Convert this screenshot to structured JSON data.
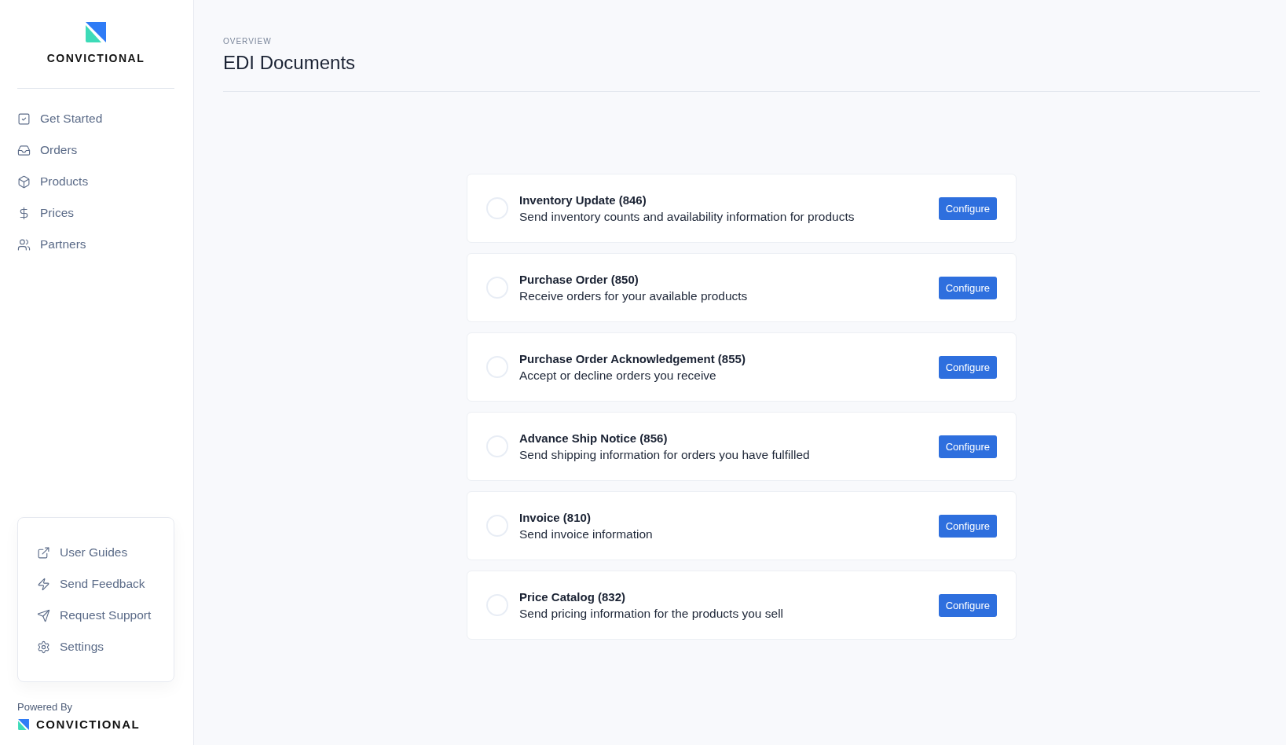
{
  "sidebar": {
    "brand": "CONVICTIONAL",
    "nav": [
      {
        "label": "Get Started"
      },
      {
        "label": "Orders"
      },
      {
        "label": "Products"
      },
      {
        "label": "Prices"
      },
      {
        "label": "Partners"
      }
    ],
    "help": [
      {
        "label": "User Guides"
      },
      {
        "label": "Send Feedback"
      },
      {
        "label": "Request Support"
      },
      {
        "label": "Settings"
      }
    ],
    "powered_by": "Powered By",
    "footer_brand": "CONVICTIONAL"
  },
  "header": {
    "eyebrow": "OVERVIEW",
    "title": "EDI Documents"
  },
  "documents": [
    {
      "title": "Inventory Update (846)",
      "description": "Send inventory counts and availability information for products",
      "enabled": false,
      "action": "Configure"
    },
    {
      "title": "Purchase Order (850)",
      "description": "Receive orders for your available products",
      "enabled": false,
      "action": "Configure"
    },
    {
      "title": "Purchase Order Acknowledgement (855)",
      "description": "Accept or decline orders you receive",
      "enabled": false,
      "action": "Configure"
    },
    {
      "title": "Advance Ship Notice (856)",
      "description": "Send shipping information for orders you have fulfilled",
      "enabled": false,
      "action": "Configure"
    },
    {
      "title": "Invoice (810)",
      "description": "Send invoice information",
      "enabled": false,
      "action": "Configure"
    },
    {
      "title": "Price Catalog (832)",
      "description": "Send pricing information for the products you sell",
      "enabled": false,
      "action": "Configure"
    }
  ]
}
